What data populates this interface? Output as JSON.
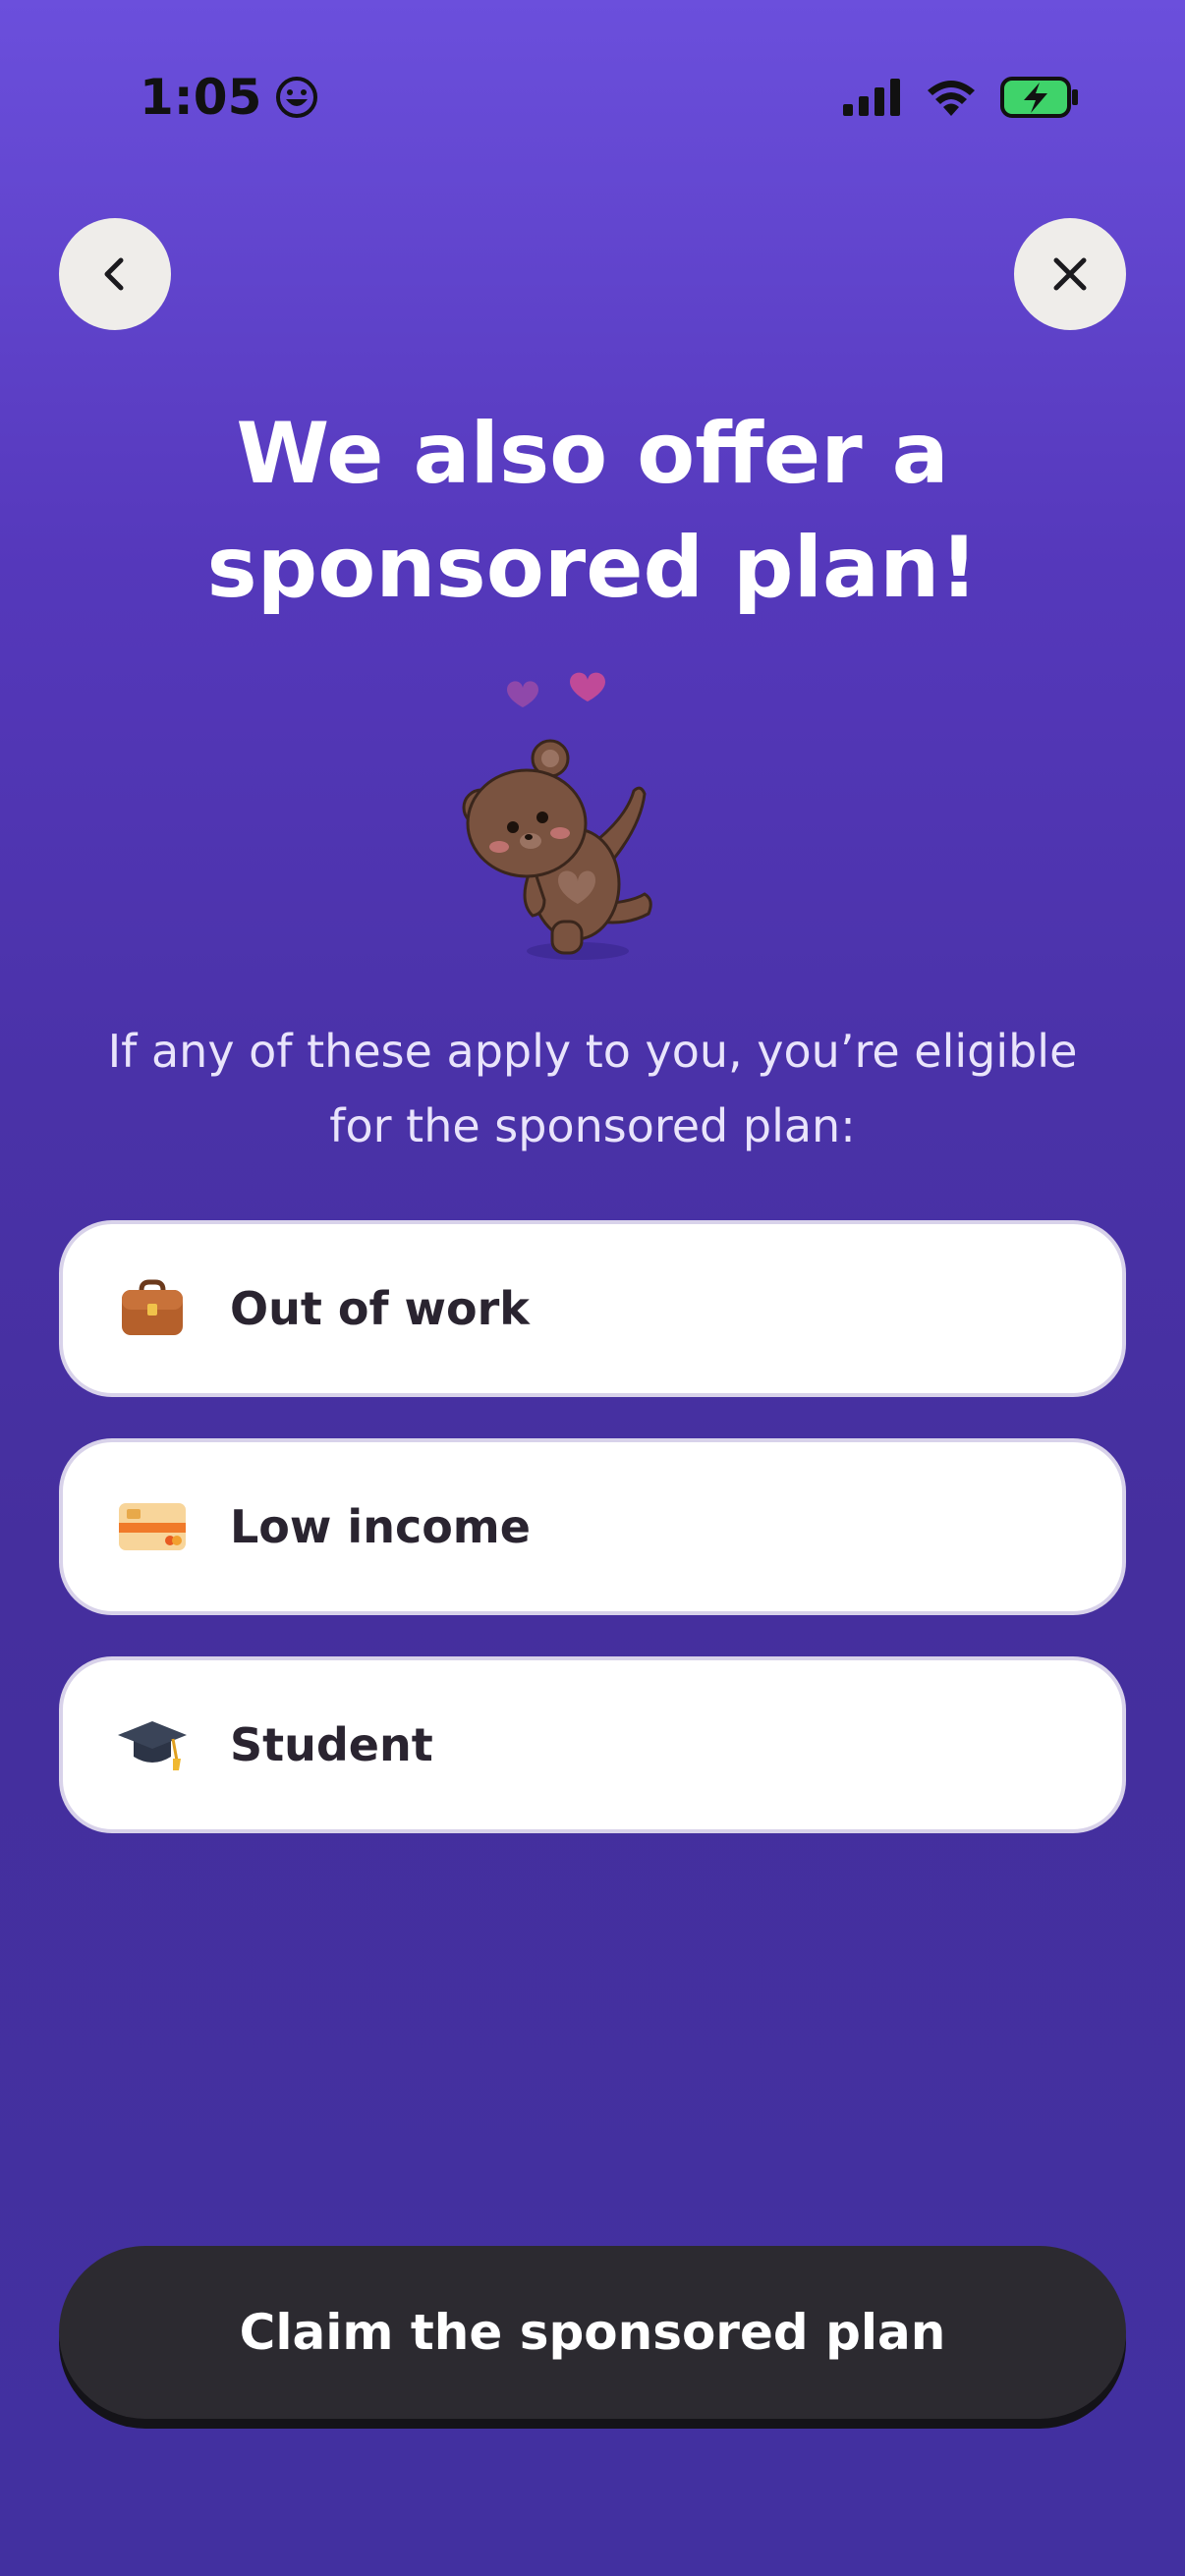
{
  "status_bar": {
    "time": "1:05",
    "icons": [
      "smiley-icon",
      "signal-icon",
      "wifi-icon",
      "battery-charging-icon"
    ]
  },
  "nav": {
    "back_icon": "chevron-left-icon",
    "close_icon": "close-icon"
  },
  "title": "We also offer a\nsponsored plan!",
  "illustration": "bear-with-hearts",
  "subtitle": "If any of these apply to you, you’re eligible for the sponsored plan:",
  "options": [
    {
      "label": "Out of work",
      "icon": "briefcase-icon"
    },
    {
      "label": "Low income",
      "icon": "credit-card-icon"
    },
    {
      "label": "Student",
      "icon": "graduation-cap-icon"
    }
  ],
  "cta": {
    "label": "Claim the sponsored plan"
  },
  "colors": {
    "background_top": "#6b4fdc",
    "background_bottom": "#4230a0",
    "card": "#ffffff",
    "button": "#2c2a30"
  }
}
